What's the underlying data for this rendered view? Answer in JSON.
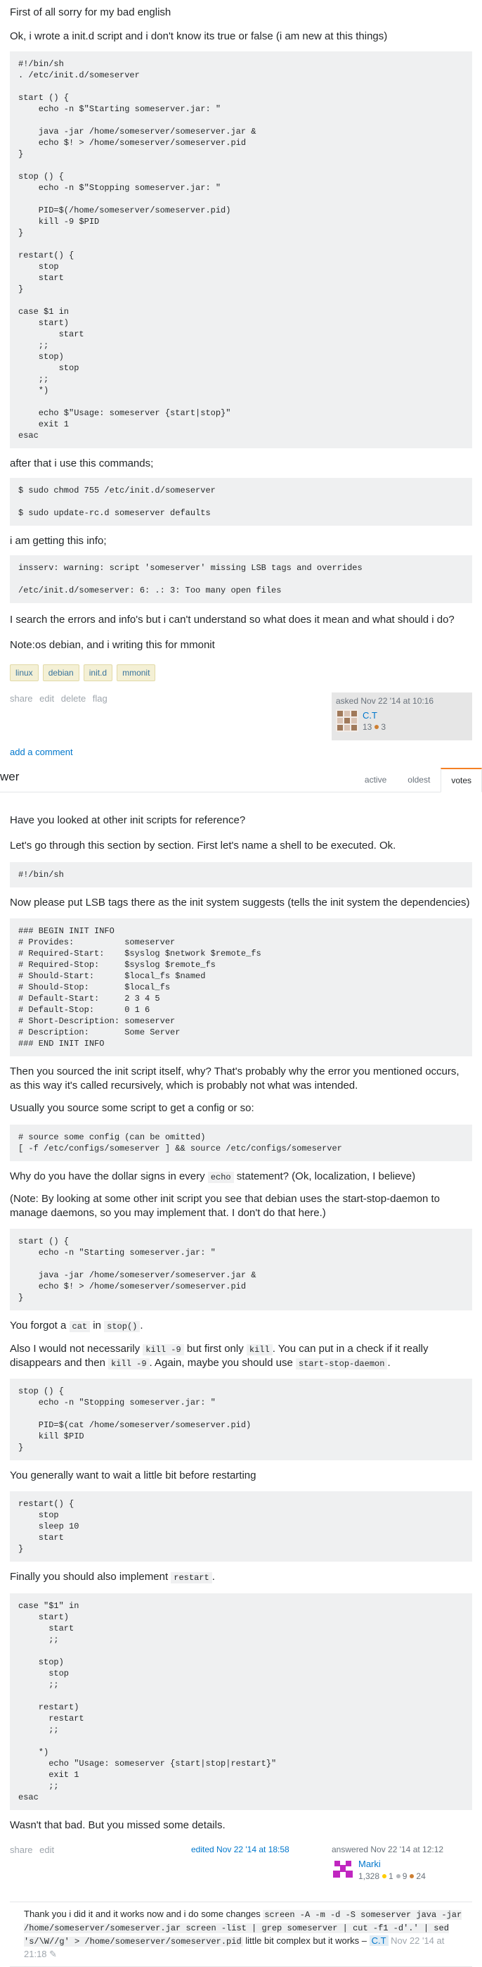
{
  "question": {
    "p1": "First of all sorry for my bad english",
    "p2": "Ok, i wrote a init.d script and i don't know its true or false (i am new at this things)",
    "code1": "#!/bin/sh\n. /etc/init.d/someserver\n\nstart () {\n    echo -n $\"Starting someserver.jar: \"\n\n    java -jar /home/someserver/someserver.jar &\n    echo $! > /home/someserver/someserver.pid\n}\n\nstop () {\n    echo -n $\"Stopping someserver.jar: \"\n\n    PID=$(/home/someserver/someserver.pid)\n    kill -9 $PID\n}\n\nrestart() {\n    stop\n    start\n}\n\ncase $1 in\n    start)\n        start\n    ;;\n    stop)\n        stop\n    ;;\n    *)\n\n    echo $\"Usage: someserver {start|stop}\"\n    exit 1\nesac",
    "p3": "after that i use this commands;",
    "code2": "$ sudo chmod 755 /etc/init.d/someserver\n\n$ sudo update-rc.d someserver defaults",
    "p4": "i am getting this info;",
    "code3": "insserv: warning: script 'someserver' missing LSB tags and overrides\n\n/etc/init.d/someserver: 6: .: 3: Too many open files",
    "p5": "I search the errors and info's but i can't understand so what does it mean and what should i do?",
    "p6": "Note:os debian, and i writing this for mmonit",
    "tags": [
      "linux",
      "debian",
      "init.d",
      "mmonit"
    ],
    "menu": {
      "share": "share",
      "edit": "edit",
      "delete": "delete",
      "flag": "flag"
    },
    "asked": "asked Nov 22 '14 at 10:16",
    "user": "C.T",
    "rep": "13",
    "bronze": "3",
    "add_comment": "add a comment"
  },
  "answers_header": {
    "title": "wer",
    "tabs": [
      "active",
      "oldest",
      "votes"
    ]
  },
  "answer": {
    "a1": "Have you looked at other init scripts for reference?",
    "a2": "Let's go through this section by section. First let's name a shell to be executed. Ok.",
    "c1": "#!/bin/sh",
    "a3": "Now please put LSB tags there as the init system suggests (tells the init system the dependencies)",
    "c2": "### BEGIN INIT INFO\n# Provides:          someserver\n# Required-Start:    $syslog $network $remote_fs\n# Required-Stop:     $syslog $remote_fs\n# Should-Start:      $local_fs $named\n# Should-Stop:       $local_fs\n# Default-Start:     2 3 4 5\n# Default-Stop:      0 1 6\n# Short-Description: someserver\n# Description:       Some Server\n### END INIT INFO",
    "a4": "Then you sourced the init script itself, why? That's probably why the error you mentioned occurs, as this way it's called recursively, which is probably not what was intended.",
    "a5": "Usually you source some script to get a config or so:",
    "c3": "# source some config (can be omitted)\n[ -f /etc/configs/someserver ] && source /etc/configs/someserver",
    "a6_pre": "Why do you have the dollar signs in every ",
    "a6_code": "echo",
    "a6_post": " statement? (Ok, localization, I believe)",
    "a7": "(Note: By looking at some other init script you see that debian uses the start-stop-daemon to manage daemons, so you may implement that. I don't do that here.)",
    "c4": "start () {\n    echo -n \"Starting someserver.jar: \"\n\n    java -jar /home/someserver/someserver.jar &\n    echo $! > /home/someserver/someserver.pid\n}",
    "a8_pre": "You forgot a ",
    "a8_code1": "cat",
    "a8_mid": " in ",
    "a8_code2": "stop()",
    "a8_post": ".",
    "a9_1": "Also I would not necessarily ",
    "a9_c1": "kill -9",
    "a9_2": " but first only ",
    "a9_c2": "kill",
    "a9_3": ". You can put in a check if it really disappears and then ",
    "a9_c3": "kill -9",
    "a9_4": ". Again, maybe you should use ",
    "a9_c4": "start-stop-daemon",
    "a9_5": ".",
    "c5": "stop () {\n    echo -n \"Stopping someserver.jar: \"\n\n    PID=$(cat /home/someserver/someserver.pid)\n    kill $PID\n}",
    "a10": "You generally want to wait a little bit before restarting",
    "c6": "restart() {\n    stop\n    sleep 10\n    start\n}",
    "a11_pre": "Finally you should also implement ",
    "a11_code": "restart",
    "a11_post": ".",
    "c7": "case \"$1\" in\n    start)\n      start\n      ;;\n\n    stop)\n      stop\n      ;;\n\n    restart)\n      restart\n      ;;\n\n    *)\n      echo \"Usage: someserver {start|stop|restart}\"\n      exit 1\n      ;;\nesac",
    "a12": "Wasn't that bad. But you missed some details.",
    "menu": {
      "share": "share",
      "edit": "edit"
    },
    "edited": "edited Nov 22 '14 at 18:58",
    "answered": "answered Nov 22 '14 at 12:12",
    "user": "Marki",
    "rep": "1,328",
    "gold": "1",
    "silver": "9",
    "bronze": "24"
  },
  "comment": {
    "pre": "Thank you i did it and it works now and i do some changes ",
    "code": "screen -A -m -d -S someserver java -jar /home/someserver/someserver.jar screen -list | grep someserver | cut -f1 -d'.' | sed 's/\\W//g' > /home/someserver/someserver.pid",
    "post": " little bit complex but it works –",
    "user": "C.T",
    "date": "Nov 22 '14 at 21:18"
  },
  "colors": {
    "link": "#0077cc",
    "code_bg": "#eff0f1",
    "tag_bg": "#f4f0d5",
    "accent": "#f48024"
  }
}
